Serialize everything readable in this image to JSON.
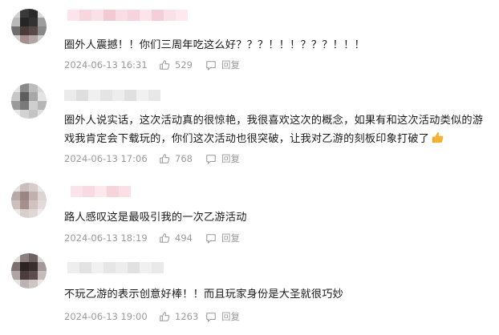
{
  "comments": [
    {
      "text": "圈外人震撼！！你们三周年吃这么好？？？！！！？？？！！！",
      "time": "2024-06-13 16:31",
      "likes": "529",
      "reply_label": "回复"
    },
    {
      "text": "圈外人说实话，这次活动真的很惊艳，我很喜欢这次的概念，如果有和这次活动类似的游戏我肯定会下载玩的，你们这次活动也很突破，让我对乙游的刻板印象打破了",
      "emoji": "thumbs-up-emoji",
      "time": "2024-06-13 17:06",
      "likes": "768",
      "reply_label": "回复"
    },
    {
      "text": "路人感叹这是最吸引我的一次乙游活动",
      "time": "2024-06-13 18:19",
      "likes": "494",
      "reply_label": "回复"
    },
    {
      "text": "不玩乙游的表示创意好棒！！而且玩家身份是大圣就很巧妙",
      "time": "2024-06-13 19:00",
      "likes": "1263",
      "reply_label": "回复"
    }
  ],
  "icons": {
    "like": "thumbs-up-outline-icon",
    "reply": "speech-bubble-icon"
  },
  "colors": {
    "text": "#1b1b1b",
    "meta": "#9a9a9a",
    "emoji": "#f5b335"
  }
}
